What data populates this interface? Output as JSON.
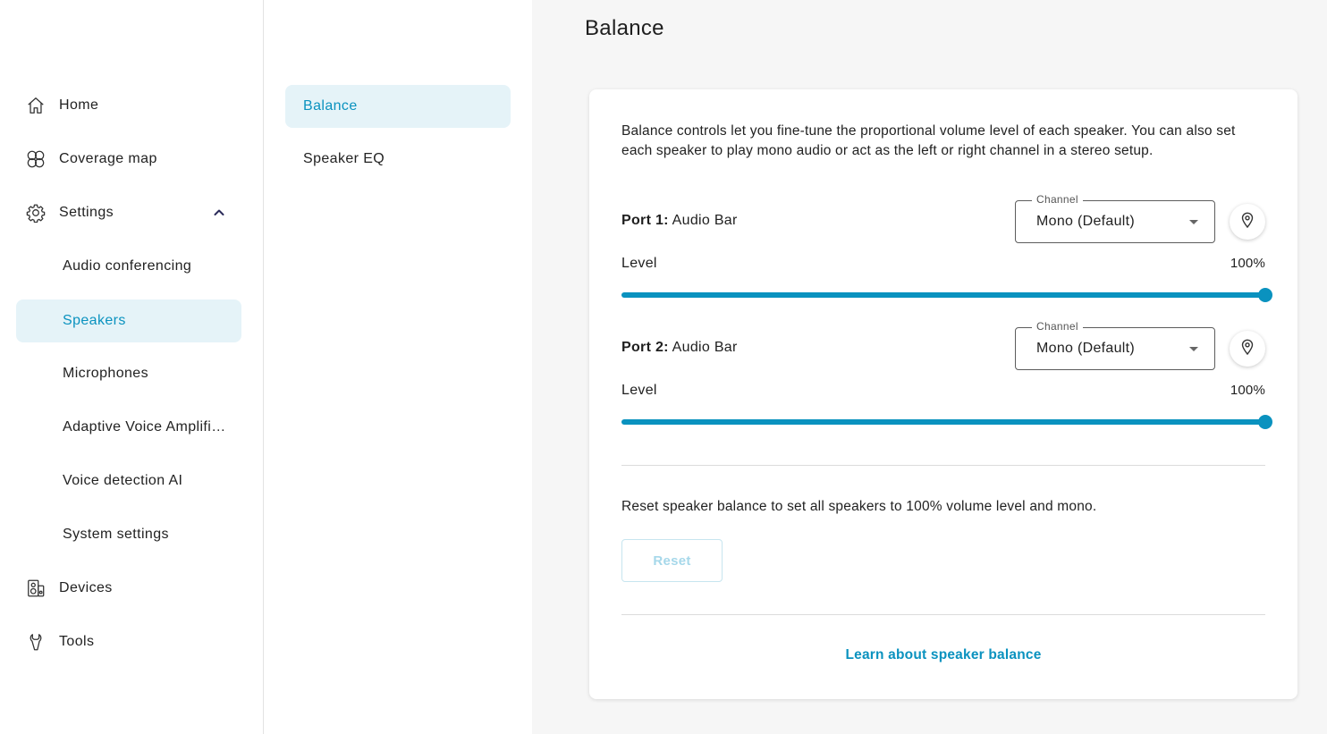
{
  "nav": {
    "home": "Home",
    "coverage_map": "Coverage map",
    "settings": "Settings",
    "settings_sub": [
      "Audio conferencing",
      "Speakers",
      "Microphones",
      "Adaptive Voice Amplifi…",
      "Voice detection AI",
      "System settings"
    ],
    "devices": "Devices",
    "tools": "Tools",
    "active_item": "Speakers"
  },
  "sub_nav": {
    "items": [
      "Balance",
      "Speaker EQ"
    ],
    "active_item": "Balance"
  },
  "page": {
    "title": "Balance",
    "intro": "Balance controls let you fine-tune the proportional volume level of each speaker. You can also set each speaker to play mono audio or act as the left or right channel in a stereo setup.",
    "ports": [
      {
        "port": "Port 1:",
        "name": "Audio Bar",
        "channel_label": "Channel",
        "channel_value": "Mono (Default)",
        "level_label": "Level",
        "level_text": "100%",
        "level": 1.0
      },
      {
        "port": "Port 2:",
        "name": "Audio Bar",
        "channel_label": "Channel",
        "channel_value": "Mono (Default)",
        "level_label": "Level",
        "level_text": "100%",
        "level": 1.0
      }
    ],
    "reset_text": "Reset speaker balance to set all speakers to 100% volume level and mono.",
    "reset_button": "Reset",
    "learn_link": "Learn about speaker balance"
  },
  "colors": {
    "accent": "#0a92bf",
    "active_bg": "#e5f3f8",
    "main_bg": "#f6f6f6"
  },
  "icons": {
    "home": "home-icon",
    "coverage_map": "coverage-map-icon",
    "settings": "gear-icon",
    "devices": "devices-icon",
    "tools": "tools-icon",
    "locate": "location-pin-icon",
    "chevron": "chevron-up-icon",
    "dropdown": "caret-down-icon"
  }
}
